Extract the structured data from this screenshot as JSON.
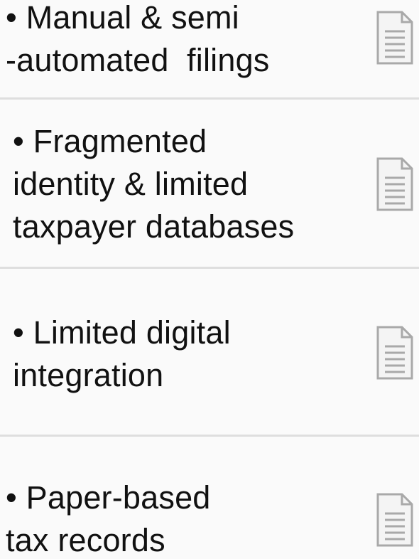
{
  "items": [
    {
      "lines": [
        "• Manual & semi",
        "-automated  filings"
      ],
      "icon": "document-icon"
    },
    {
      "lines": [
        "• Fragmented",
        "identity & limited",
        "taxpayer databases"
      ],
      "icon": "document-icon"
    },
    {
      "lines": [
        "• Limited digital",
        "integration"
      ],
      "icon": "document-icon"
    },
    {
      "lines": [
        "• Paper-based",
        "tax records"
      ],
      "icon": "document-icon"
    }
  ],
  "colors": {
    "background": "#fafafa",
    "divider": "#dedede",
    "text": "#111111",
    "icon_stroke": "#a9a9a9"
  }
}
